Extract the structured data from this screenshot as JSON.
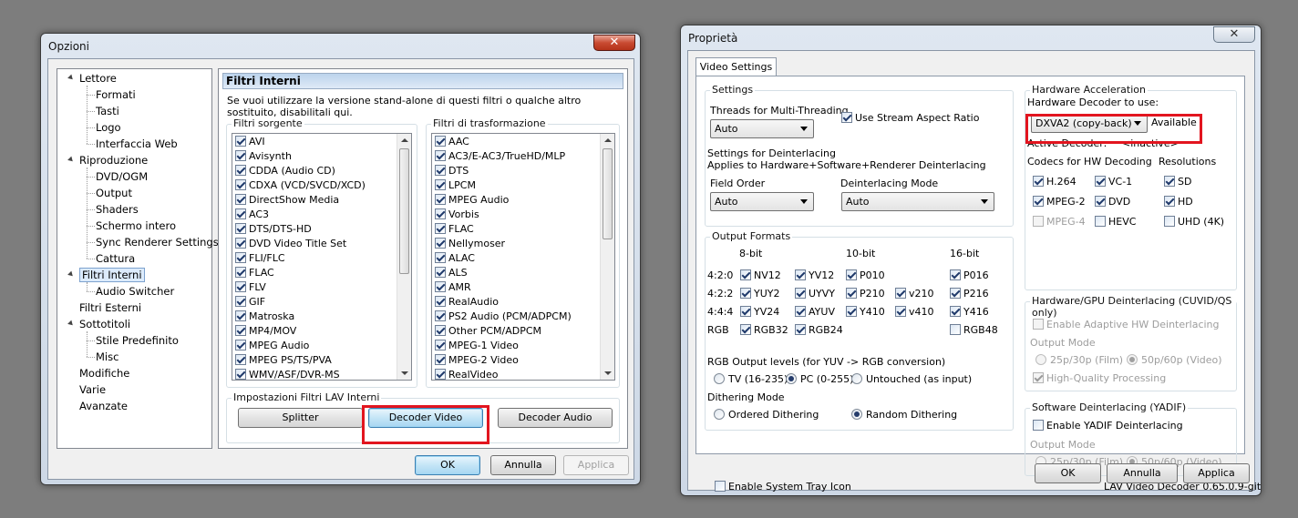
{
  "opzioni": {
    "title": "Opzioni",
    "close_label": "✕",
    "tree": [
      {
        "label": "Lettore",
        "level": 0,
        "expanded": true
      },
      {
        "label": "Formati",
        "level": 1
      },
      {
        "label": "Tasti",
        "level": 1
      },
      {
        "label": "Logo",
        "level": 1
      },
      {
        "label": "Interfaccia Web",
        "level": 1
      },
      {
        "label": "Riproduzione",
        "level": 0,
        "expanded": true
      },
      {
        "label": "DVD/OGM",
        "level": 1
      },
      {
        "label": "Output",
        "level": 1
      },
      {
        "label": "Shaders",
        "level": 1
      },
      {
        "label": "Schermo intero",
        "level": 1
      },
      {
        "label": "Sync Renderer Settings",
        "level": 1
      },
      {
        "label": "Cattura",
        "level": 1
      },
      {
        "label": "Filtri Interni",
        "level": 0,
        "expanded": true,
        "selected": true
      },
      {
        "label": "Audio Switcher",
        "level": 1
      },
      {
        "label": "Filtri Esterni",
        "level": 0
      },
      {
        "label": "Sottotitoli",
        "level": 0,
        "expanded": true
      },
      {
        "label": "Stile Predefinito",
        "level": 1
      },
      {
        "label": "Misc",
        "level": 1
      },
      {
        "label": "Modifiche",
        "level": 0
      },
      {
        "label": "Varie",
        "level": 0
      },
      {
        "label": "Avanzate",
        "level": 0
      }
    ],
    "panel_title": "Filtri Interni",
    "description": "Se vuoi utilizzare la versione stand-alone di questi filtri o qualche altro sostituito, disabilitali qui.",
    "source_filters_label": "Filtri sorgente",
    "source_filters": [
      "AVI",
      "Avisynth",
      "CDDA (Audio CD)",
      "CDXA (VCD/SVCD/XCD)",
      "DirectShow Media",
      "AC3",
      "DTS/DTS-HD",
      "DVD Video Title Set",
      "FLI/FLC",
      "FLAC",
      "FLV",
      "GIF",
      "Matroska",
      "MP4/MOV",
      "MPEG Audio",
      "MPEG PS/TS/PVA",
      "WMV/ASF/DVR-MS"
    ],
    "transform_filters_label": "Filtri di trasformazione",
    "transform_filters": [
      "AAC",
      "AC3/E-AC3/TrueHD/MLP",
      "DTS",
      "LPCM",
      "MPEG Audio",
      "Vorbis",
      "FLAC",
      "Nellymoser",
      "ALAC",
      "ALS",
      "AMR",
      "RealAudio",
      "PS2 Audio (PCM/ADPCM)",
      "Other PCM/ADPCM",
      "MPEG-1 Video",
      "MPEG-2 Video",
      "RealVideo"
    ],
    "lav_group_label": "Impostazioni Filtri LAV Interni",
    "splitter_button": "Splitter",
    "decoder_video_button": "Decoder Video",
    "decoder_audio_button": "Decoder Audio",
    "ok_button": "OK",
    "cancel_button": "Annulla",
    "apply_button": "Applica"
  },
  "proprieta": {
    "title": "Proprietà",
    "close_label": "✕",
    "tab_label": "Video Settings",
    "settings": {
      "group_label": "Settings",
      "threads_label": "Threads for Multi-Threading",
      "threads_value": "Auto",
      "stream_aspect_label": "Use Stream Aspect Ratio",
      "stream_aspect_checked": true,
      "deint_line1": "Settings for Deinterlacing",
      "deint_line2": "Applies to Hardware+Software+Renderer Deinterlacing",
      "field_order_label": "Field Order",
      "field_order_value": "Auto",
      "deint_mode_label": "Deinterlacing Mode",
      "deint_mode_value": "Auto"
    },
    "output_formats": {
      "group_label": "Output Formats",
      "col_8bit": "8-bit",
      "col_10bit": "10-bit",
      "col_16bit": "16-bit",
      "rows": [
        {
          "label": "4:2:0",
          "items": [
            {
              "t": "NV12",
              "c": true
            },
            {
              "t": "YV12",
              "c": true
            },
            {
              "t": "P010",
              "c": true
            },
            {
              "t": "",
              "c": false
            },
            {
              "t": "P016",
              "c": true
            }
          ]
        },
        {
          "label": "4:2:2",
          "items": [
            {
              "t": "YUY2",
              "c": true
            },
            {
              "t": "UYVY",
              "c": true
            },
            {
              "t": "P210",
              "c": true
            },
            {
              "t": "v210",
              "c": true
            },
            {
              "t": "P216",
              "c": true
            }
          ]
        },
        {
          "label": "4:4:4",
          "items": [
            {
              "t": "YV24",
              "c": true
            },
            {
              "t": "AYUV",
              "c": true
            },
            {
              "t": "Y410",
              "c": true
            },
            {
              "t": "v410",
              "c": true
            },
            {
              "t": "Y416",
              "c": true
            }
          ]
        },
        {
          "label": "RGB",
          "items": [
            {
              "t": "RGB32",
              "c": true
            },
            {
              "t": "RGB24",
              "c": true
            },
            {
              "t": "",
              "c": false
            },
            {
              "t": "",
              "c": false
            },
            {
              "t": "RGB48",
              "c": false
            }
          ]
        }
      ],
      "rgb_levels_label": "RGB Output levels (for YUV -> RGB conversion)",
      "rgb_tv": "TV (16-235)",
      "rgb_pc": "PC (0-255)",
      "rgb_untouched": "Untouched (as input)",
      "dithering_label": "Dithering Mode",
      "dither_ordered": "Ordered Dithering",
      "dither_random": "Random Dithering"
    },
    "hw": {
      "group_label": "Hardware Acceleration",
      "decoder_label": "Hardware Decoder to use:",
      "decoder_value": "DXVA2 (copy-back)",
      "status": "Available",
      "active_label": "Active Decoder:",
      "active_value": "<inactive>",
      "codecs_label": "Codecs for HW Decoding",
      "resolutions_label": "Resolutions",
      "codecs": [
        {
          "t": "H.264",
          "c": true,
          "d": false
        },
        {
          "t": "VC-1",
          "c": true,
          "d": false
        },
        {
          "t": "MPEG-2",
          "c": true,
          "d": false
        },
        {
          "t": "DVD",
          "c": true,
          "d": false
        },
        {
          "t": "MPEG-4",
          "c": false,
          "d": true
        },
        {
          "t": "HEVC",
          "c": false,
          "d": false
        }
      ],
      "resolutions": [
        {
          "t": "SD",
          "c": true
        },
        {
          "t": "HD",
          "c": true
        },
        {
          "t": "UHD (4K)",
          "c": false
        }
      ]
    },
    "gpu_deint": {
      "group_label": "Hardware/GPU Deinterlacing (CUVID/QS only)",
      "adaptive_label": "Enable Adaptive HW Deinterlacing",
      "output_mode_label": "Output Mode",
      "film_label": "25p/30p (Film)",
      "video_label": "50p/60p (Video)",
      "hq_label": "High-Quality Processing"
    },
    "sw_deint": {
      "group_label": "Software Deinterlacing (YADIF)",
      "yadif_label": "Enable YADIF Deinterlacing",
      "output_mode_label": "Output Mode",
      "film_label": "25p/30p (Film)",
      "video_label": "50p/60p (Video)"
    },
    "tray_label": "Enable System Tray Icon",
    "version": "LAV Video Decoder 0.65.0.9-git",
    "ok_button": "OK",
    "cancel_button": "Annulla",
    "apply_button": "Applica"
  },
  "colors": {
    "highlight": "#e2151f",
    "default_button": "#3c7fb1"
  }
}
